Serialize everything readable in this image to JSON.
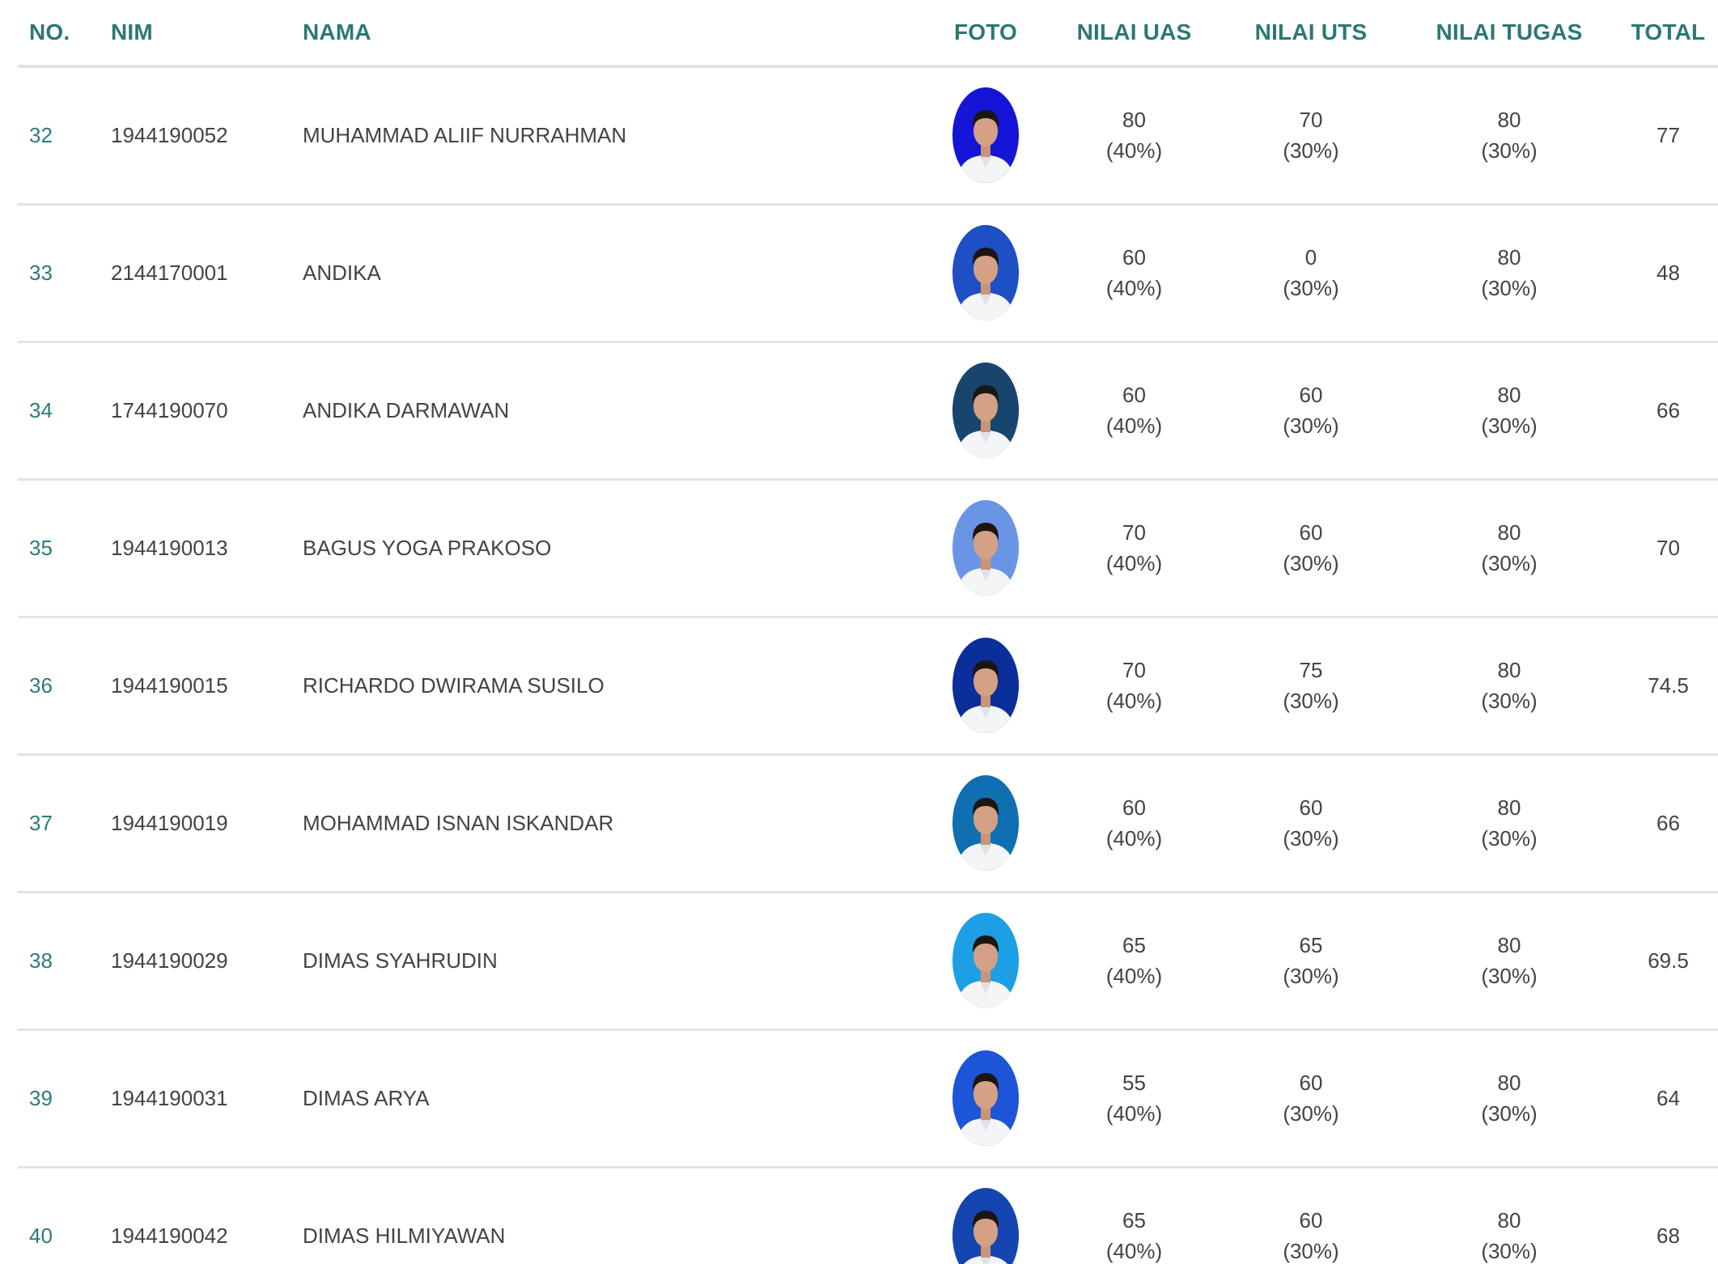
{
  "table": {
    "headers": {
      "no": "NO.",
      "nim": "NIM",
      "nama": "NAMA",
      "foto": "FOTO",
      "uas": "NILAI UAS",
      "uts": "NILAI UTS",
      "tugas": "NILAI TUGAS",
      "total": "TOTAL"
    },
    "weights": {
      "uas": "(40%)",
      "uts": "(30%)",
      "tugas": "(30%)"
    },
    "rows": [
      {
        "no": "32",
        "nim": "1944190052",
        "nama": "MUHAMMAD ALIIF NURRAHMAN",
        "uas": "80",
        "uts": "70",
        "tugas": "80",
        "total": "77",
        "photo_bg": "#1515d8"
      },
      {
        "no": "33",
        "nim": "2144170001",
        "nama": "ANDIKA",
        "uas": "60",
        "uts": "0",
        "tugas": "80",
        "total": "48",
        "photo_bg": "#1f4fc4"
      },
      {
        "no": "34",
        "nim": "1744190070",
        "nama": "ANDIKA DARMAWAN",
        "uas": "60",
        "uts": "60",
        "tugas": "80",
        "total": "66",
        "photo_bg": "#17456e"
      },
      {
        "no": "35",
        "nim": "1944190013",
        "nama": "BAGUS YOGA PRAKOSO",
        "uas": "70",
        "uts": "60",
        "tugas": "80",
        "total": "70",
        "photo_bg": "#6a95e4"
      },
      {
        "no": "36",
        "nim": "1944190015",
        "nama": "RICHARDO DWIRAMA SUSILO",
        "uas": "70",
        "uts": "75",
        "tugas": "80",
        "total": "74.5",
        "photo_bg": "#0a2e9a"
      },
      {
        "no": "37",
        "nim": "1944190019",
        "nama": "MOHAMMAD ISNAN ISKANDAR",
        "uas": "60",
        "uts": "60",
        "tugas": "80",
        "total": "66",
        "photo_bg": "#0f6fb0"
      },
      {
        "no": "38",
        "nim": "1944190029",
        "nama": "DIMAS SYAHRUDIN",
        "uas": "65",
        "uts": "65",
        "tugas": "80",
        "total": "69.5",
        "photo_bg": "#1d9fe6"
      },
      {
        "no": "39",
        "nim": "1944190031",
        "nama": "DIMAS ARYA",
        "uas": "55",
        "uts": "60",
        "tugas": "80",
        "total": "64",
        "photo_bg": "#1c55d8"
      },
      {
        "no": "40",
        "nim": "1944190042",
        "nama": "DIMAS HILMIYAWAN",
        "uas": "65",
        "uts": "60",
        "tugas": "80",
        "total": "68",
        "photo_bg": "#1545b0"
      }
    ]
  }
}
